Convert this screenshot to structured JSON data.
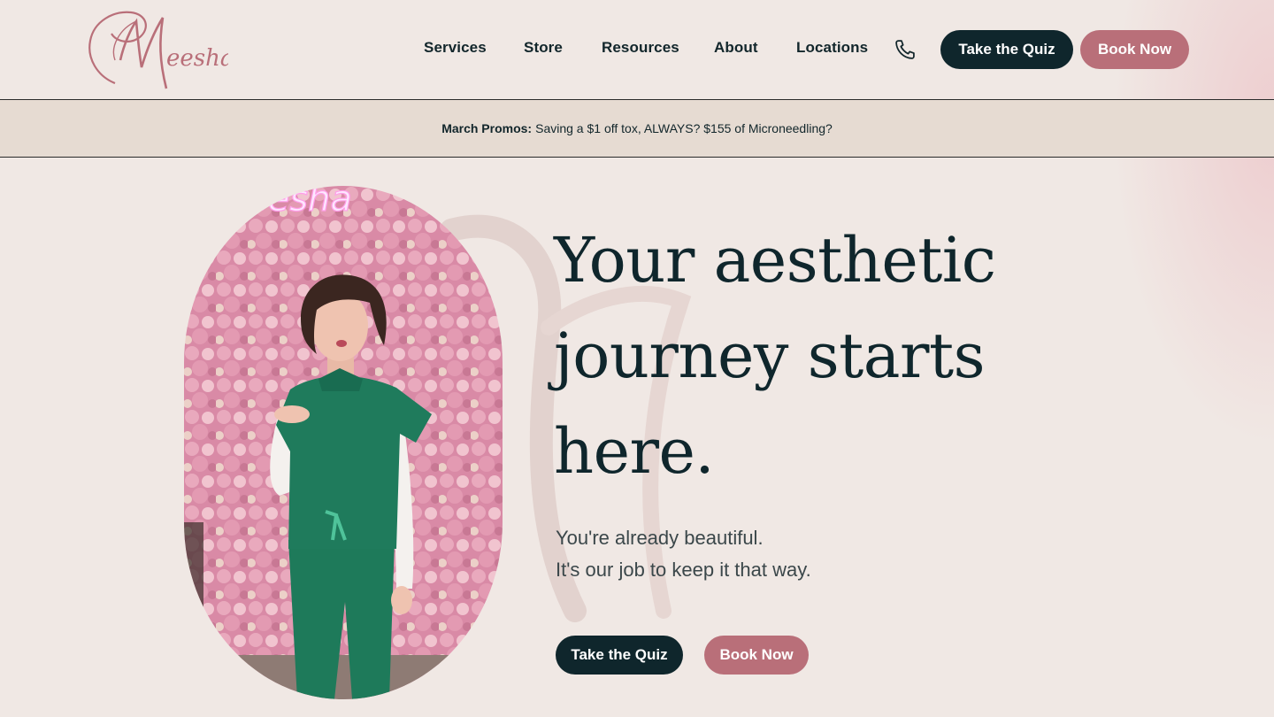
{
  "brand": {
    "logo_text": "Meesha",
    "accent_color": "#b96f79",
    "dark_color": "#0f262c"
  },
  "nav": {
    "items": [
      {
        "label": "Services"
      },
      {
        "label": "Store"
      },
      {
        "label": "Resources"
      },
      {
        "label": "About"
      },
      {
        "label": "Locations"
      }
    ],
    "phone_icon": "phone-icon",
    "quiz_label": "Take the Quiz",
    "book_label": "Book Now"
  },
  "promo": {
    "title": "March Promos:",
    "text": "Saving a $1 off tox, ALWAYS? $155 of Microneedling?"
  },
  "hero": {
    "headline_lines": [
      "Your aesthetic",
      "journey starts",
      "here."
    ],
    "subline_lines": [
      "You're already beautiful.",
      "It's our job to keep it that way."
    ],
    "quiz_label": "Take the Quiz",
    "book_label": "Book Now",
    "photo_neon_text": "eesha"
  }
}
